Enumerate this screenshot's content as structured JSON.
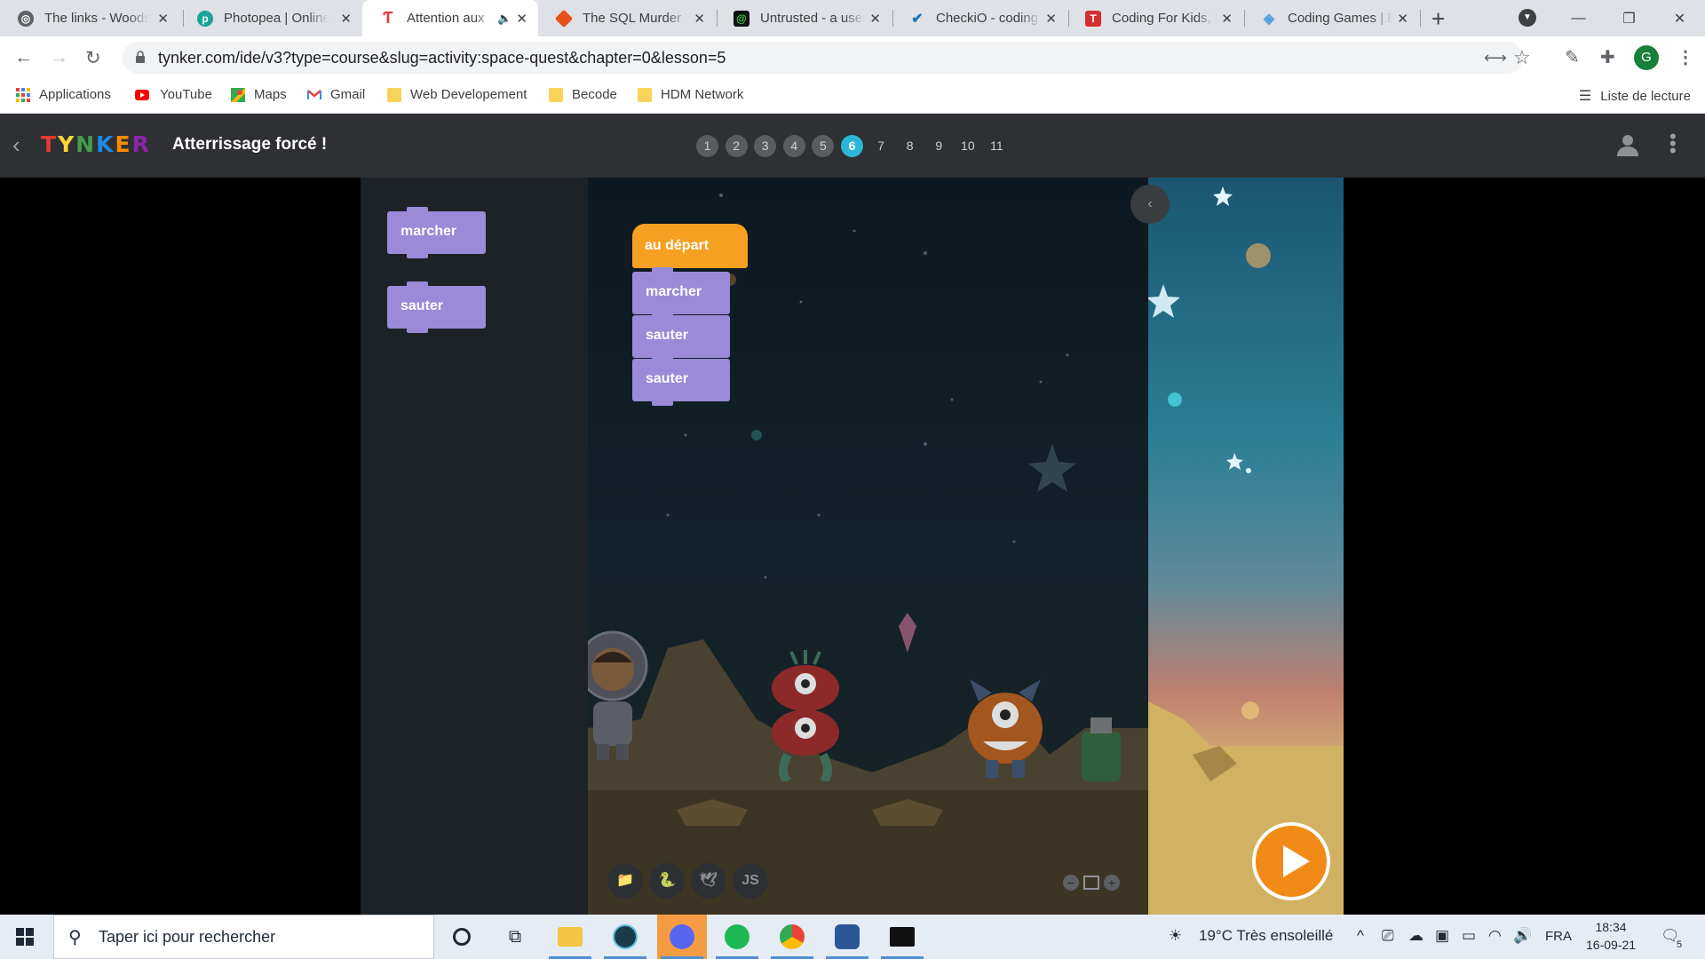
{
  "browser": {
    "tabs": [
      {
        "title": "The links - Woods",
        "icon": "globe-icon",
        "color": "#5f6368"
      },
      {
        "title": "Photopea | Online",
        "icon": "photopea-icon",
        "color": "#18a497"
      },
      {
        "title": "Attention aux",
        "icon": "tynker-icon",
        "color": "#e53935",
        "active": true,
        "audio": "🔈"
      },
      {
        "title": "The SQL Murder M",
        "icon": "diamond-icon",
        "color": "#e8501d"
      },
      {
        "title": "Untrusted - a user",
        "icon": "untrusted-icon",
        "color": "#111111"
      },
      {
        "title": "CheckiO - coding",
        "icon": "checkio-icon",
        "color": "#1a73b8"
      },
      {
        "title": "Coding For Kids, K",
        "icon": "tynker-red-icon",
        "color": "#d32f2f"
      },
      {
        "title": "Coding Games | E",
        "icon": "codinggames-icon",
        "color": "#4fa3d9"
      }
    ],
    "url": "tynker.com/ide/v3?type=course&slug=activity:space-quest&chapter=0&lesson=5",
    "profile_initial": "G",
    "bookmarks": [
      {
        "label": "Applications",
        "icon": "apps-grid-icon"
      },
      {
        "label": "YouTube",
        "icon": "youtube-icon"
      },
      {
        "label": "Maps",
        "icon": "maps-icon"
      },
      {
        "label": "Gmail",
        "icon": "gmail-icon"
      },
      {
        "label": "Web Developement",
        "icon": "folder-icon"
      },
      {
        "label": "Becode",
        "icon": "folder-icon"
      },
      {
        "label": "HDM Network",
        "icon": "folder-icon"
      }
    ],
    "reading_list": "Liste de lecture"
  },
  "tynker": {
    "logo": "TYNKER",
    "title": "Atterrissage forcé !",
    "lessons": [
      "1",
      "2",
      "3",
      "4",
      "5",
      "6",
      "7",
      "8",
      "9",
      "10",
      "11"
    ],
    "current_lesson": "6",
    "palette_blocks": [
      "marcher",
      "sauter"
    ],
    "script": {
      "hat": "au départ",
      "blocks": [
        "marcher",
        "sauter",
        "sauter"
      ]
    },
    "lang_buttons": [
      "📁",
      "🐍",
      "🕊",
      "JS"
    ],
    "zoom": {
      "minus": "−",
      "plus": "+"
    }
  },
  "taskbar": {
    "search_placeholder": "Taper ici pour rechercher",
    "weather": "19°C  Très ensoleillé",
    "language": "FRA",
    "time": "18:34",
    "date": "16-09-21",
    "notifications": "5"
  }
}
